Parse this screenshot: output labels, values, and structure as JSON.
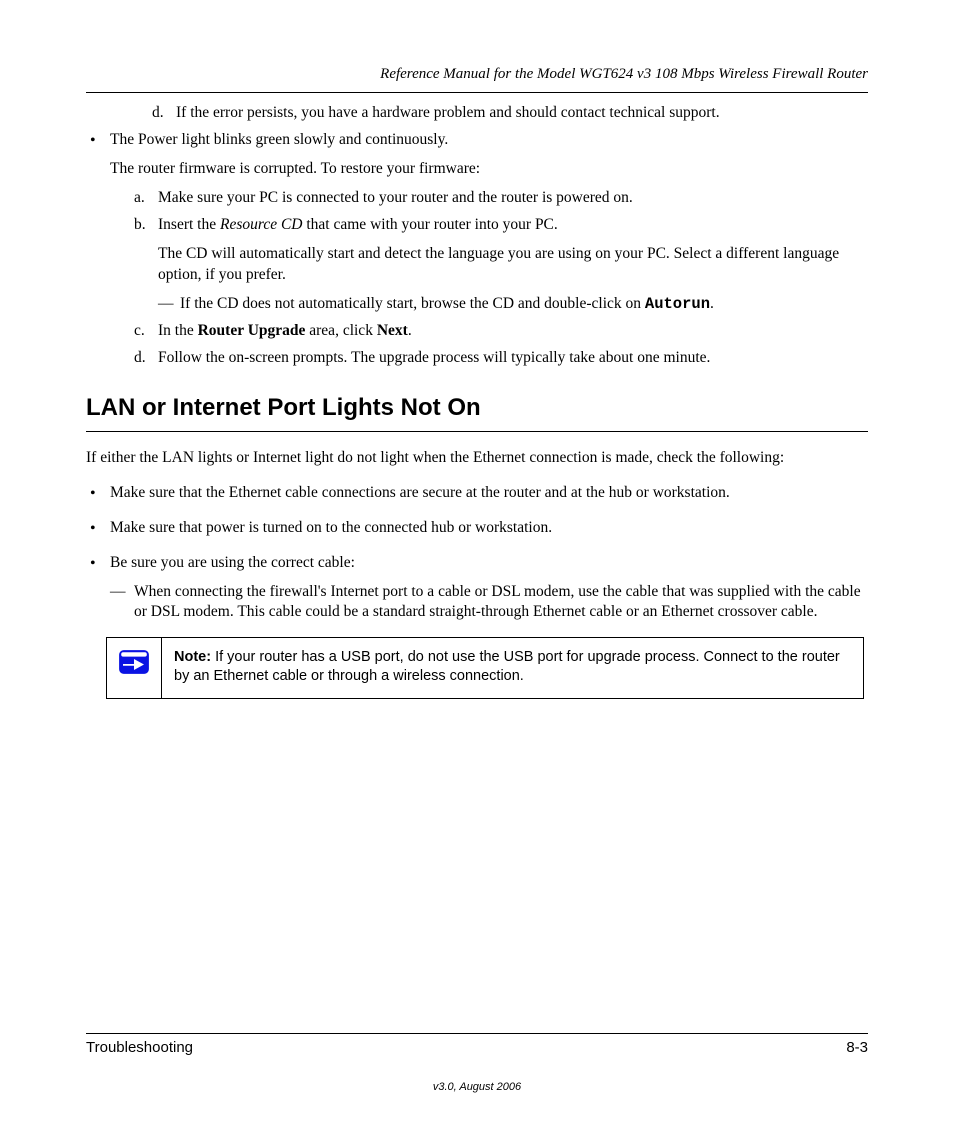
{
  "header": {
    "doc_title": "Reference Manual for the Model WGT624 v3 108 Mbps Wireless Firewall Router"
  },
  "section_a": {
    "item_d": "If the error persists, you have a hardware problem and should contact technical support.",
    "bullet_label": "The Power light blinks green slowly and continuously.",
    "bullet_body": "The router firmware is corrupted. To restore your firmware:",
    "step_a": "Make sure your PC is connected to your router and the router is powered on.",
    "step_b_1": "Insert the ",
    "step_b_em": "Resource CD",
    "step_b_2": " that came with your router into your PC.",
    "step_b_sub": "The CD will automatically start and detect the language you are using on your PC. Select a different language option, if you prefer.",
    "note_1": "If the CD does not automatically start, browse the CD and double-click on ",
    "note_autorun": "Autorun",
    "note_2": ".",
    "step_c_prefix": "In the ",
    "step_c_bold1": "Router Upgrade",
    "step_c_mid": " area, click ",
    "step_c_bold2": "Next",
    "step_c_suffix": ".",
    "step_d": "Follow the on-screen prompts. The upgrade process will typically take about one minute."
  },
  "section_b": {
    "heading": "LAN or Internet Port Lights Not On",
    "intro": "If either the LAN lights or Internet light do not light when the Ethernet connection is made, check the following:",
    "bullet1": "Make sure that the Ethernet cable connections are secure at the router and at the hub or workstation.",
    "bullet2": "Make sure that power is turned on to the connected hub or workstation.",
    "bullet3_1": "Be sure you are using the correct cable: ",
    "bullet3_2": "When connecting the firewall's Internet port to a cable or DSL modem, use the cable that was supplied with the cable or DSL modem. This cable could be a standard straight-through Ethernet cable or an Ethernet crossover cable.",
    "note_bold": "Note:",
    "note_text": " If your router has a USB port, do not use the USB port for upgrade process. Connect to the router by an Ethernet cable or through a wireless connection."
  },
  "footer": {
    "left": "Troubleshooting",
    "right": "8-3",
    "version": "v3.0, August 2006"
  }
}
